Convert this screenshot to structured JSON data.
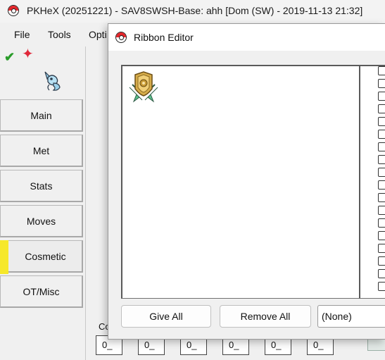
{
  "window": {
    "title": "PKHeX (20251221) - SAV8SWSH-Base: ahh [Dom (SW) - 2019-11-13 21:32]"
  },
  "menu": {
    "items": [
      "File",
      "Tools",
      "Opti"
    ]
  },
  "icons": {
    "app": "pokeball-icon",
    "save_ok": "checkmark-icon",
    "shiny": "sparkle-icon",
    "sprite": "pokemon-sprite-icon",
    "ribbon": "ribbon-badge-icon"
  },
  "tabs": [
    {
      "label": "Main"
    },
    {
      "label": "Met"
    },
    {
      "label": "Stats"
    },
    {
      "label": "Moves"
    },
    {
      "label": "Cosmetic",
      "active": true
    },
    {
      "label": "OT/Misc"
    }
  ],
  "bottom": {
    "label": "Co",
    "fields": [
      "0_",
      "0_",
      "0_",
      "0_",
      "0_",
      "0_"
    ]
  },
  "dialog": {
    "title": "Ribbon Editor",
    "give_all_label": "Give All",
    "remove_all_label": "Remove All",
    "select_value": "(None)"
  },
  "colors": {
    "tab_indicator": "#f6e82a",
    "pokeball_red": "#e3262b",
    "check_green": "#2a9c2a",
    "sparkle_red": "#e0283a"
  }
}
